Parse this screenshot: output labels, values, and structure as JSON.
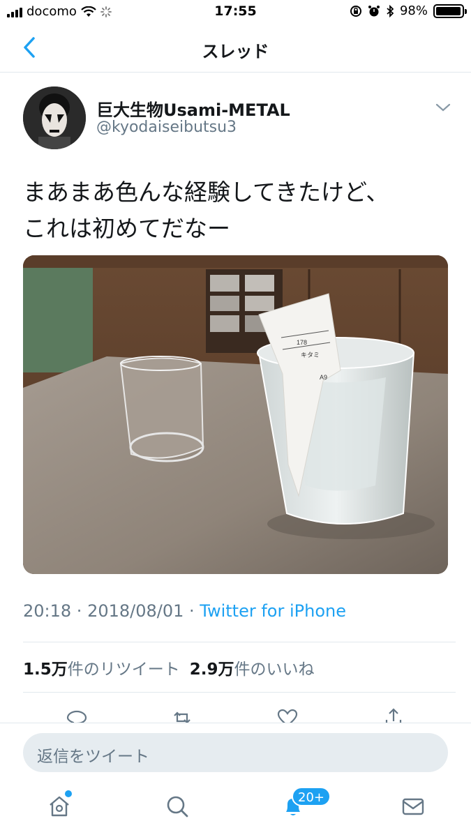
{
  "status_bar": {
    "carrier": "docomo",
    "time": "17:55",
    "battery_percent": "98%",
    "battery_level": 0.98
  },
  "nav": {
    "title": "スレッド",
    "back_icon": "chevron-left-icon"
  },
  "tweet": {
    "user_name": "巨大生物Usami-METAL",
    "user_handle": "@kyodaiseibutsu3",
    "text_line1": "まあまあ色んな経験してきたけど、",
    "text_line2": "これは初めてだなー",
    "photo_receipt_text1": "178",
    "photo_receipt_text2": "キタミ",
    "photo_receipt_text3": "A9",
    "time": "20:18",
    "sep1": " · ",
    "date": "2018/08/01",
    "sep2": " · ",
    "source": "Twitter for iPhone",
    "retweet_count": "1.5万",
    "retweet_label": "件のリツイート",
    "like_count": "2.9万",
    "like_label": "件のいいね"
  },
  "actions": [
    "reply-icon",
    "retweet-icon",
    "heart-icon",
    "share-icon"
  ],
  "reply": {
    "placeholder": "返信をツイート"
  },
  "tab_bar": {
    "notifications_badge": "20+",
    "icons": [
      "home-icon",
      "search-icon",
      "notifications-icon",
      "messages-icon"
    ]
  },
  "colors": {
    "accent": "#1da1f2",
    "secondary_text": "#657786",
    "divider": "#e1e8ed"
  }
}
